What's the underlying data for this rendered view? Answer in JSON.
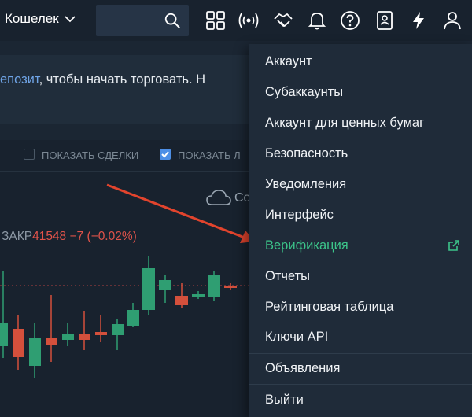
{
  "header": {
    "wallet_label": "Кошелек",
    "icons": [
      "grid-icon",
      "broadcast-icon",
      "handshake-icon",
      "bell-icon",
      "help-icon",
      "contacts-icon",
      "lightning-icon",
      "user-icon"
    ]
  },
  "banner": {
    "link_text": "епозит",
    "text": ", чтобы начать торговать. Н"
  },
  "chart_toolbar": {
    "show_trades": "ПОКАЗАТЬ СДЕЛКИ",
    "show_second": "ПОКАЗАТЬ Л",
    "cloud_text": "Со"
  },
  "price": {
    "label": "ЗАКР",
    "close": "41548",
    "change": "−7 (−0.02%)"
  },
  "menu": {
    "items": [
      {
        "label": "Аккаунт"
      },
      {
        "label": "Субаккаунты"
      },
      {
        "label": "Аккаунт для ценных бумаг"
      },
      {
        "label": "Безопасность"
      },
      {
        "label": "Уведомления"
      },
      {
        "label": "Интерфейс"
      },
      {
        "label": "Верификация"
      },
      {
        "label": "Отчеты"
      },
      {
        "label": "Рейтинговая таблица"
      },
      {
        "label": "Ключи API"
      },
      {
        "label": "Объявления"
      },
      {
        "label": "Выйти"
      }
    ]
  },
  "colors": {
    "background": "#1b2633",
    "menu_bg": "#1f2b39",
    "accent_green": "#3cc48a",
    "accent_red": "#e0534a",
    "link_blue": "#6fa4e6",
    "arrow_red": "#e2442d"
  }
}
